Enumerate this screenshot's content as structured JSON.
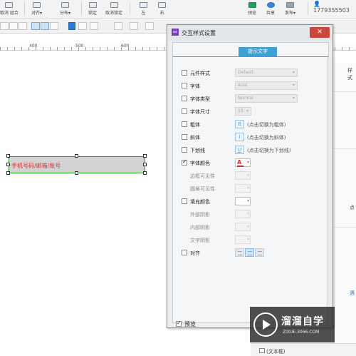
{
  "toolbar": {
    "items": [
      {
        "label": "取消 组合",
        "icon": "group-icon"
      },
      {
        "label": "对齐▾",
        "icon": "align-icon"
      },
      {
        "label": "分布▾",
        "icon": "distribute-icon"
      },
      {
        "label": "锁定",
        "icon": "lock-icon"
      },
      {
        "label": "取消锁定",
        "icon": "unlock-icon"
      },
      {
        "label": "左",
        "icon": "arrange-left-icon"
      },
      {
        "label": "右",
        "icon": "arrange-right-icon"
      },
      {
        "label": "预览",
        "icon": "preview-icon"
      },
      {
        "label": "共享",
        "icon": "share-icon"
      },
      {
        "label": "发布▾",
        "icon": "publish-icon"
      }
    ],
    "user": "1779355503"
  },
  "ruler": {
    "labels": [
      "400",
      "500",
      "600"
    ]
  },
  "canvas": {
    "widget_text": "手机号码/邮箱/账号"
  },
  "right_panel": {
    "label_top": "样式",
    "label_mid": "点",
    "label_bottom": "遇"
  },
  "dialog": {
    "title": "交互样式设置",
    "close_icon": "close-icon",
    "tab": "提示文字",
    "rows": [
      {
        "label": "元件样式",
        "checked": false,
        "disabled": false,
        "control": "select",
        "value": "Default"
      },
      {
        "label": "字体",
        "checked": false,
        "disabled": false,
        "control": "select",
        "value": "Arial"
      },
      {
        "label": "字体类型",
        "checked": false,
        "disabled": false,
        "control": "select",
        "value": "Normal"
      },
      {
        "label": "字体尺寸",
        "checked": false,
        "disabled": false,
        "control": "select-small",
        "value": "13"
      },
      {
        "label": "粗体",
        "checked": false,
        "disabled": false,
        "control": "toggle",
        "hint": "(点击切换为粗体)"
      },
      {
        "label": "斜体",
        "checked": false,
        "disabled": false,
        "control": "toggle",
        "hint": "(点击切换为斜体)"
      },
      {
        "label": "下划线",
        "checked": false,
        "disabled": false,
        "control": "toggle",
        "hint": "(点击切换为下划线)"
      },
      {
        "label": "字体颜色",
        "checked": true,
        "disabled": false,
        "control": "color-font"
      },
      {
        "label": "边框可见性",
        "checked": false,
        "disabled": true,
        "control": "color-disabled"
      },
      {
        "label": "圆角可见性",
        "checked": false,
        "disabled": true,
        "control": "color-disabled"
      },
      {
        "label": "填充颜色",
        "checked": false,
        "disabled": false,
        "control": "color"
      },
      {
        "label": "外部阴影",
        "checked": false,
        "disabled": true,
        "control": "color-disabled"
      },
      {
        "label": "内部阴影",
        "checked": false,
        "disabled": true,
        "control": "color-disabled"
      },
      {
        "label": "文字阴影",
        "checked": false,
        "disabled": true,
        "control": "color-disabled"
      },
      {
        "label": "对齐",
        "checked": false,
        "disabled": false,
        "control": "align"
      }
    ],
    "preview_label": "预览",
    "preview_checked": true
  },
  "watermark": {
    "title": "溜溜自学",
    "url": "ZIXUE.3066.COM"
  },
  "bottom_strip": {
    "label": "(文本框)"
  }
}
